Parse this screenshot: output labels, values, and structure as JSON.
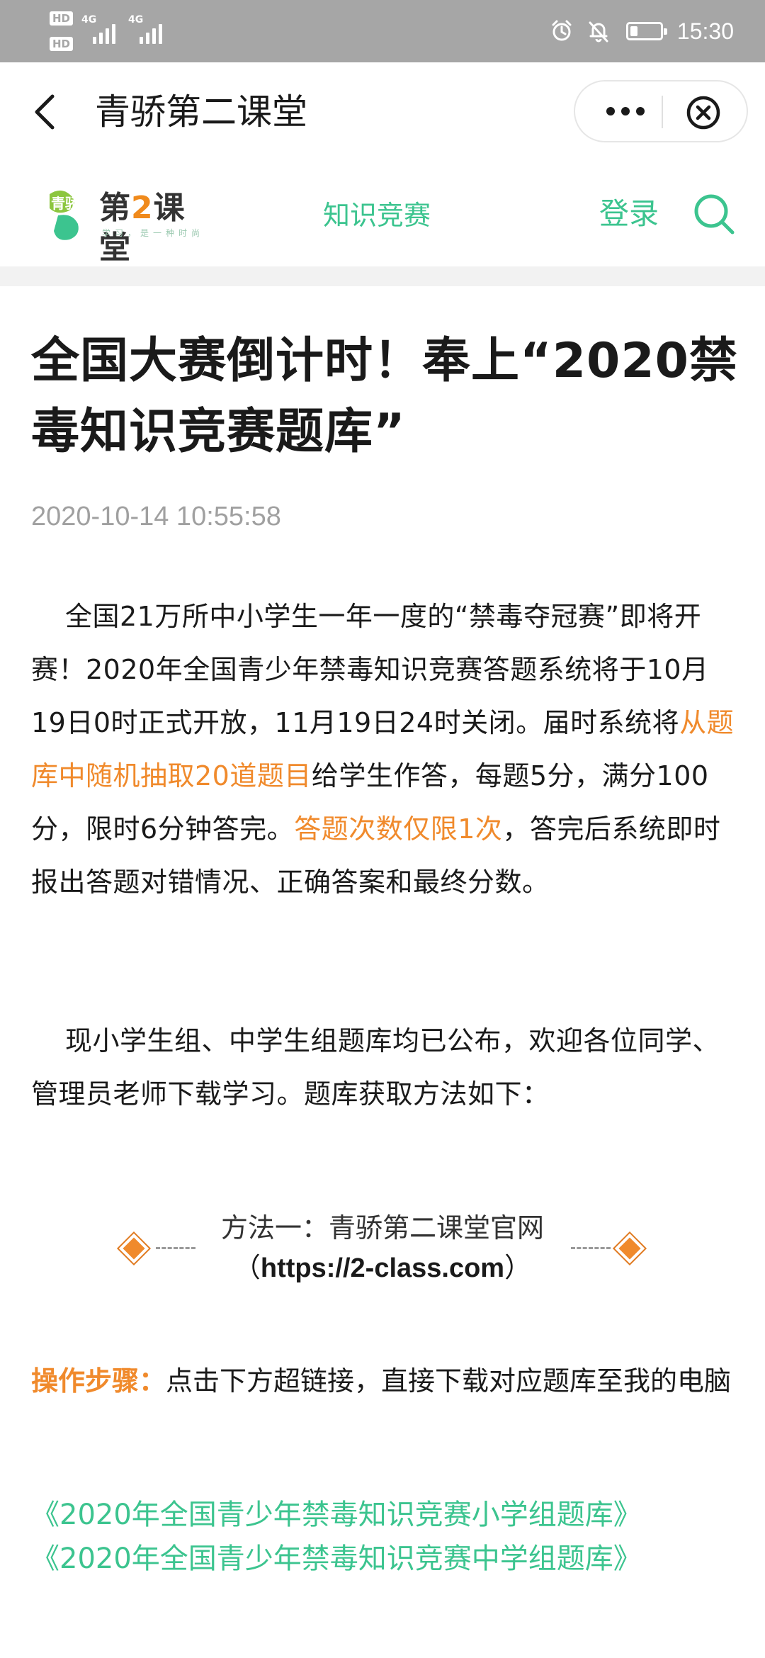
{
  "status_bar": {
    "hd1": "HD",
    "hd2": "HD",
    "net1": "4G",
    "net2": "4G",
    "time": "15:30",
    "battery_level": 0.25
  },
  "nav": {
    "title": "青骄第二课堂"
  },
  "header": {
    "logo_qing": "青骄",
    "logo_main_prefix": "第",
    "logo_main_two": "2",
    "logo_main_suffix": "课堂",
    "logo_sub": "学习，是一种时尚",
    "contest_link": "知识竞赛",
    "login_link": "登录"
  },
  "article": {
    "title": "全国大赛倒计时！奉上“2020禁毒知识竞赛题库”",
    "date": "2020-10-14 10:55:58",
    "p1_a": "全国21万所中小学生一年一度的“禁毒夺冠赛”即将开赛！2020年全国青少年禁毒知识竞赛答题系统将于10月19日0时正式开放，11月19日24时关闭。届时系统将",
    "p1_hl1": "从题库中随机抽取20道题目",
    "p1_b": "给学生作答，每题5分，满分100分，限时6分钟答完。",
    "p1_hl2": "答题次数仅限1次",
    "p1_c": "，答完后系统即时报出答题对错情况、正确答案和最终分数。",
    "p2": "现小学生组、中学生组题库均已公布，欢迎各位同学、管理员老师下载学习。题库获取方法如下：",
    "method_title": "方法一：青骄第二课堂官网",
    "method_url_open": "（",
    "method_url": "https://2-class.com",
    "method_url_close": "）",
    "steps_label": "操作步骤：",
    "steps_text": "点击下方超链接，直接下载对应题库至我的电脑",
    "link_primary": "《2020年全国青少年禁毒知识竞赛小学组题库》",
    "link_middle": "《2020年全国青少年禁毒知识竞赛中学组题库》"
  },
  "colors": {
    "accent_green": "#3cc48f",
    "highlight_orange": "#f08a2c",
    "status_bar_gray": "#a6a6a6"
  }
}
